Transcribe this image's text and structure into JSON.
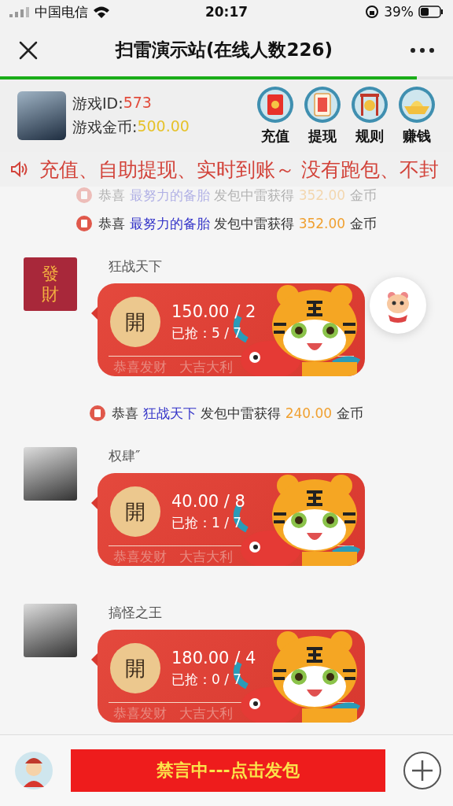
{
  "status_bar": {
    "carrier": "中国电信",
    "time": "20:17",
    "battery": "39%"
  },
  "nav": {
    "title": "扫雷演示站(在线人数226)",
    "progress": {
      "level": 0.92
    }
  },
  "account": {
    "id_label": "游戏ID:",
    "id_value": "573",
    "coins_label": "游戏金币:",
    "coins_value": "500.00"
  },
  "actions": [
    {
      "kind": "recharge",
      "label": "充值"
    },
    {
      "kind": "withdraw",
      "label": "提现"
    },
    {
      "kind": "rules",
      "label": "规则"
    },
    {
      "kind": "earn",
      "label": "赚钱"
    }
  ],
  "marquee": {
    "text": "充值、自助提现、实时到账～ 没有跑包、不封"
  },
  "feed": [
    {
      "kind": "notice",
      "faded": true,
      "prefix": "恭喜",
      "name": "最努力的备胎",
      "action": "发包中雷获得",
      "amount": "352.00",
      "unit": "金币"
    },
    {
      "kind": "notice",
      "faded": false,
      "prefix": "恭喜",
      "name": "最努力的备胎",
      "action": "发包中雷获得",
      "amount": "352.00",
      "unit": "金币"
    },
    {
      "kind": "packet",
      "sender": "狂战天下",
      "avatar": {
        "kind": "text",
        "text": "發財"
      },
      "open_label": "開",
      "amount": "150.00 / 2",
      "grabbed": "已抢：5 / 7",
      "footer": "恭喜发财   大吉大利"
    },
    {
      "kind": "notice",
      "faded": false,
      "prefix": "恭喜",
      "name": "狂战天下",
      "action": "发包中雷获得",
      "amount": "240.00",
      "unit": "金币"
    },
    {
      "kind": "packet",
      "sender": "权肆″",
      "avatar": {
        "kind": "photo"
      },
      "open_label": "開",
      "amount": "40.00 / 8",
      "grabbed": "已抢：1 / 7",
      "footer": "恭喜发财   大吉大利"
    },
    {
      "kind": "packet",
      "sender": "搞怪之王",
      "avatar": {
        "kind": "photo"
      },
      "open_label": "開",
      "amount": "180.00 / 4",
      "grabbed": "已抢：0 / 7",
      "footer": "恭喜发财   大吉大利"
    }
  ],
  "footer": {
    "button": "禁言中---点击发包"
  }
}
